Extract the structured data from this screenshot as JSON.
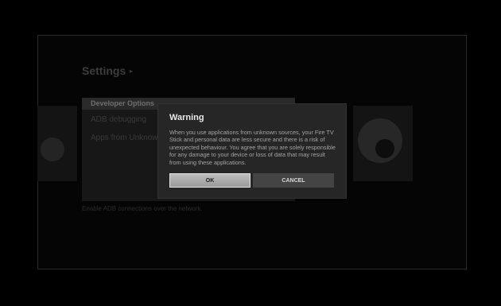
{
  "background": {
    "title": "Settings",
    "title_arrow": "▸",
    "panel": {
      "header": "Developer Options",
      "rows": [
        "ADB debugging",
        "Apps from Unknown Sources"
      ]
    },
    "help_text": "Enable ADB connections over the network."
  },
  "dialog": {
    "title": "Warning",
    "message": "When you use applications from unknown sources, your Fire TV Stick and personal data are less secure and there is a risk of unexpected behaviour. You agree that you are solely responsible for any damage to your device or loss of data that may result from using these applications.",
    "ok_label": "OK",
    "cancel_label": "CANCEL"
  },
  "colors": {
    "background": "#000000",
    "dialog_bg": "#262626",
    "ok_button": "#b5b5b5",
    "cancel_button": "#444444"
  }
}
